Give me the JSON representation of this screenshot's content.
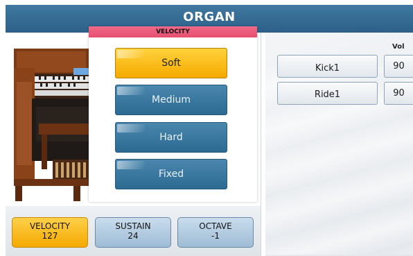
{
  "header": {
    "title": "ORGAN"
  },
  "dialog": {
    "title": "VELOCITY",
    "options": [
      {
        "label": "Soft",
        "selected": true
      },
      {
        "label": "Medium",
        "selected": false
      },
      {
        "label": "Hard",
        "selected": false
      },
      {
        "label": "Fixed",
        "selected": false
      }
    ]
  },
  "drum_panel": {
    "vol_header": "Vol",
    "rows": [
      {
        "instrument": "Kick1",
        "vol": "90"
      },
      {
        "instrument": "Ride1",
        "vol": "90"
      }
    ]
  },
  "tabs": [
    {
      "label": "VELOCITY",
      "value": "127"
    },
    {
      "label": "SUSTAIN",
      "value": "24"
    },
    {
      "label": "OCTAVE",
      "value": "-1"
    }
  ],
  "colors": {
    "title_bar": "#2d6088",
    "accent": "#f5aa00",
    "dialog_header": "#e64d6f"
  }
}
